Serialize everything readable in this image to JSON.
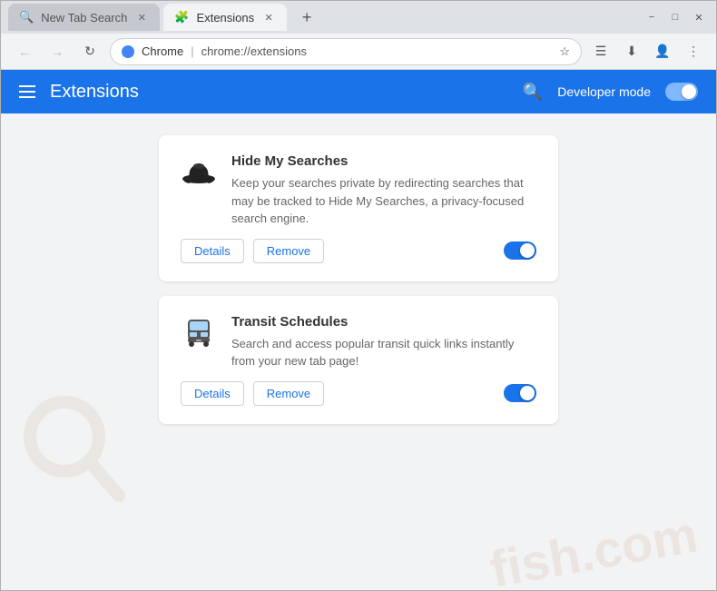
{
  "browser": {
    "tabs": [
      {
        "id": "new-tab-search",
        "label": "New Tab Search",
        "icon": "🔍",
        "active": false
      },
      {
        "id": "extensions",
        "label": "Extensions",
        "icon": "🧩",
        "active": true
      }
    ],
    "new_tab_btn": "+",
    "window_controls": [
      "−",
      "□",
      "✕"
    ],
    "address_bar": {
      "favicon": "chrome",
      "site": "Chrome",
      "separator": "|",
      "url": "chrome://extensions"
    },
    "nav_icons": [
      "★",
      "☰",
      "⬇",
      "👤",
      "⋮"
    ]
  },
  "extensions_page": {
    "header": {
      "menu_icon": "☰",
      "title": "Extensions",
      "search_icon": "🔍",
      "developer_mode_label": "Developer mode"
    },
    "cards": [
      {
        "id": "hide-my-searches",
        "name": "Hide My Searches",
        "description": "Keep your searches private by redirecting searches that may be tracked to Hide My Searches, a privacy-focused search engine.",
        "details_btn": "Details",
        "remove_btn": "Remove",
        "enabled": true
      },
      {
        "id": "transit-schedules",
        "name": "Transit Schedules",
        "description": "Search and access popular transit quick links instantly from your new tab page!",
        "details_btn": "Details",
        "remove_btn": "Remove",
        "enabled": true
      }
    ]
  }
}
